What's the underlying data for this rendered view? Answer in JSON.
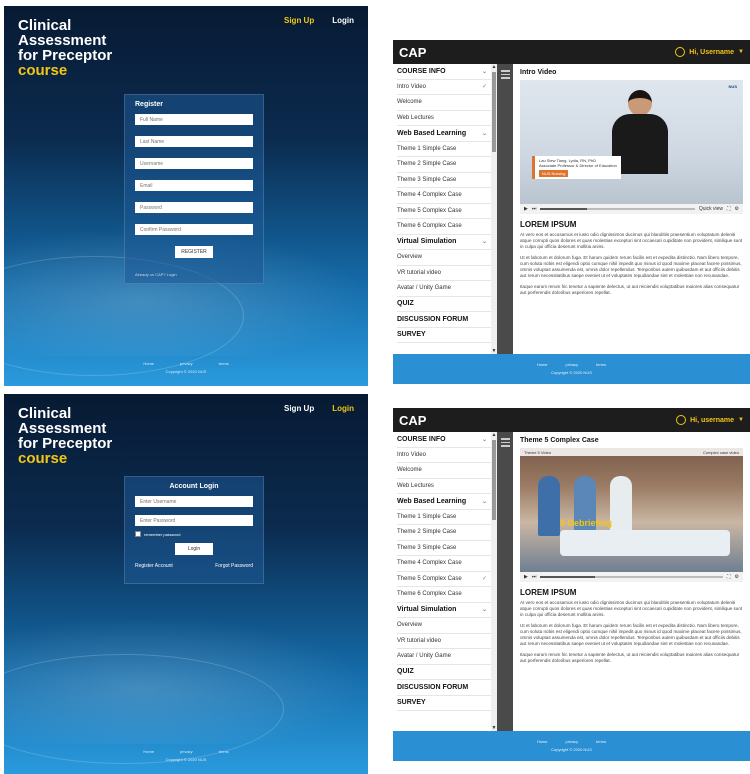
{
  "brand": {
    "line1": "Clinical",
    "line2": "Assessment",
    "line3": "for Preceptor",
    "line4": "course"
  },
  "nav": {
    "signup": "Sign Up",
    "login": "Login"
  },
  "register": {
    "title": "Register",
    "fields": [
      "Full Name",
      "Last Name",
      "Username",
      "Email",
      "Password",
      "Confirm Password"
    ],
    "button": "REGISTER",
    "note": "Already on CAP? Login"
  },
  "login_form": {
    "title": "Account Login",
    "username_ph": "Enter Username",
    "password_ph": "Enter Password",
    "remember": "remember password",
    "button": "Login",
    "register_link": "Register Account",
    "forgot_link": "Forgot Password"
  },
  "auth_footer": {
    "links": [
      "Home",
      "privacy",
      "terms"
    ],
    "copyright": "Copyright © 2020 NUS"
  },
  "app": {
    "logo": "CAP",
    "user_p3": "Hi, Username",
    "user_p4": "Hi, username",
    "footer_links": [
      "Home",
      "privacy",
      "terms"
    ],
    "copyright": "Copyright © 2020 NUS"
  },
  "sidebar": [
    {
      "label": "COURSE INFO",
      "section": true,
      "mark": "⌄"
    },
    {
      "label": "Intro Video",
      "section": false,
      "mark": "✓"
    },
    {
      "label": "Welcome",
      "section": false,
      "mark": ""
    },
    {
      "label": "Web Lectures",
      "section": false,
      "mark": ""
    },
    {
      "label": "Web Based Learning",
      "section": true,
      "mark": "⌄"
    },
    {
      "label": "Theme 1 Simple Case",
      "section": false,
      "mark": ""
    },
    {
      "label": "Theme 2 Simple Case",
      "section": false,
      "mark": ""
    },
    {
      "label": "Theme 3 Simple Case",
      "section": false,
      "mark": ""
    },
    {
      "label": "Theme 4 Complex Case",
      "section": false,
      "mark": ""
    },
    {
      "label": "Theme 5 Complex Case",
      "section": false,
      "mark": ""
    },
    {
      "label": "Theme 6 Complex Case",
      "section": false,
      "mark": ""
    },
    {
      "label": "Virtual Simulation",
      "section": true,
      "mark": "⌄"
    },
    {
      "label": "Overview",
      "section": false,
      "mark": ""
    },
    {
      "label": "VR tutorial video",
      "section": false,
      "mark": ""
    },
    {
      "label": "Avatar / Unity Game",
      "section": false,
      "mark": ""
    },
    {
      "label": "QUIZ",
      "section": true,
      "mark": ""
    },
    {
      "label": "DISCUSSION FORUM",
      "section": true,
      "mark": ""
    },
    {
      "label": "SURVEY",
      "section": true,
      "mark": ""
    }
  ],
  "sidebar_p4_marks": {
    "intro": "",
    "theme5": "✓"
  },
  "video1": {
    "title": "Intro Video",
    "speaker_name": "Lau Siew Tiang, Lydia, RN, PhD",
    "speaker_role": "Associate Professor & Director of Education",
    "speaker_org": "NUS Nursing",
    "logo": "NUS",
    "quality": "Quick view"
  },
  "video2": {
    "title": "Theme 5 Complex Case",
    "header_left": "Theme 5 Video",
    "header_right": "Complex case video",
    "overlay": "5 Debriefing"
  },
  "lorem": {
    "heading": "LOREM IPSUM",
    "p1": "At vero eos et accusamus et iusto odio dignissimos ducimus qui blanditiis praesentium voluptatum deleniti atque corrupti quos dolores et quas molestias excepturi sint occaecati cupiditate non provident, similique sunt in culpa qui officia deserunt mollitia animi.",
    "p2": "Ut et laborum et dolorum fuga. Et harum quidem rerum facilis est et expedita distinctio. Nam libero tempore, cum soluta nobis est eligendi optio cumque nihil impedit quo minus id quod maxime placeat facere possimus, omnis voluptas assumenda est, omnis dolor repellendus. Temporibus autem quibusdam et aut officiis debitis aut rerum necessitatibus saepe eveniet ut et voluptates repudiandae sint et molestiae non recusandae.",
    "p3": "Itaque earum rerum hic tenetur a sapiente delectus, ut aut reiciendis voluptatibus maiores alias consequatur aut perferendis doloribus asperiores repellat."
  }
}
